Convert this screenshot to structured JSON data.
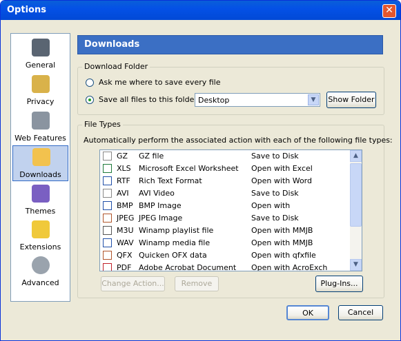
{
  "window": {
    "title": "Options",
    "close_label": "✕"
  },
  "sidebar": {
    "items": [
      {
        "label": "General"
      },
      {
        "label": "Privacy"
      },
      {
        "label": "Web Features"
      },
      {
        "label": "Downloads"
      },
      {
        "label": "Themes"
      },
      {
        "label": "Extensions"
      },
      {
        "label": "Advanced"
      }
    ],
    "selected": "Downloads"
  },
  "header": {
    "title": "Downloads"
  },
  "download_folder": {
    "legend": "Download Folder",
    "ask_label": "Ask me where to save every file",
    "save_label": "Save all files to this folder:",
    "folder_value": "Desktop",
    "show_folder_label": "Show Folder"
  },
  "file_types": {
    "legend": "File Types",
    "description": "Automatically perform the associated action with each of the following file types:",
    "rows": [
      {
        "ext": "GZ",
        "desc": "GZ file",
        "action": "Save to Disk"
      },
      {
        "ext": "XLS",
        "desc": "Microsoft Excel Worksheet",
        "action": "Open with Excel"
      },
      {
        "ext": "RTF",
        "desc": "Rich Text Format",
        "action": "Open with Word"
      },
      {
        "ext": "AVI",
        "desc": "AVI Video",
        "action": "Save to Disk"
      },
      {
        "ext": "BMP",
        "desc": "BMP Image",
        "action": "Open with"
      },
      {
        "ext": "JPEG",
        "desc": "JPEG Image",
        "action": "Save to Disk"
      },
      {
        "ext": "M3U",
        "desc": "Winamp playlist file",
        "action": "Open with MMJB"
      },
      {
        "ext": "WAV",
        "desc": "Winamp media file",
        "action": "Open with MMJB"
      },
      {
        "ext": "QFX",
        "desc": "Quicken OFX data",
        "action": "Open with qfxfile"
      },
      {
        "ext": "PDF",
        "desc": "Adobe Acrobat Document",
        "action": "Open with AcroExch"
      }
    ],
    "change_action_label": "Change Action...",
    "remove_label": "Remove",
    "plugins_label": "Plug-Ins..."
  },
  "footer": {
    "ok_label": "OK",
    "cancel_label": "Cancel"
  },
  "colors": {
    "titlebar": "#0451e6",
    "header": "#3b6fc4",
    "selection": "#c1d2ee",
    "dialog_bg": "#ece9d8"
  }
}
